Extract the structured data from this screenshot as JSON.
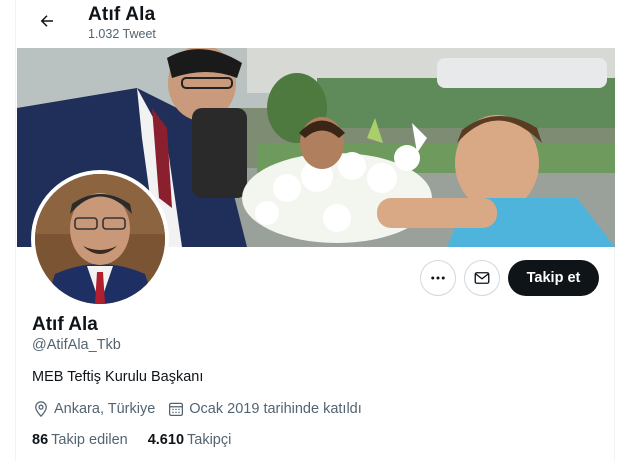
{
  "header": {
    "name": "Atıf Ala",
    "tweet_count": "1.032 Tweet"
  },
  "icons": {
    "back": "arrow-left-icon",
    "more": "more-horizontal-icon",
    "message": "envelope-icon",
    "location": "location-pin-icon",
    "joined": "calendar-icon"
  },
  "actions": {
    "follow_label": "Takip et"
  },
  "profile": {
    "name": "Atıf Ala",
    "handle": "@AtifAla_Tkb",
    "bio": "MEB Teftiş Kurulu Başkanı",
    "location": "Ankara, Türkiye",
    "joined": "Ocak 2019 tarihinde katıldı"
  },
  "stats": {
    "following_count": "86",
    "following_label": "Takip edilen",
    "followers_count": "4.610",
    "followers_label": "Takipçi"
  },
  "colors": {
    "text_primary": "#0f1419",
    "text_secondary": "#536471",
    "border": "#cfd9de",
    "button_dark": "#0f1419"
  }
}
